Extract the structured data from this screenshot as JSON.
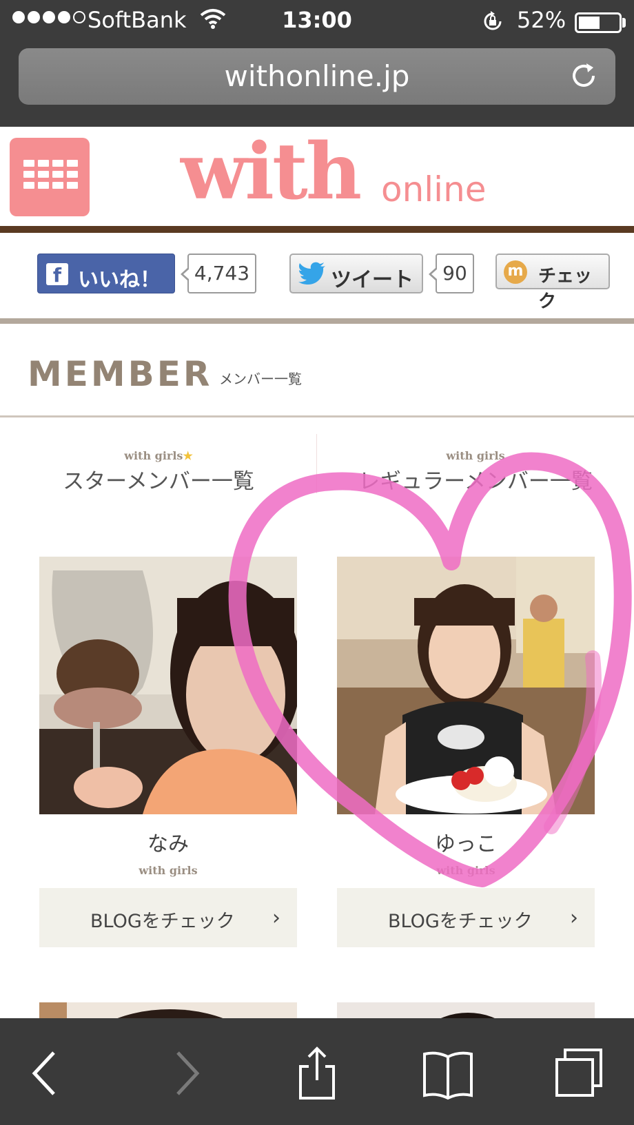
{
  "status_bar": {
    "carrier": "SoftBank",
    "time": "13:00",
    "battery_percent": "52%",
    "battery_level": 0.52,
    "signal_bars_filled": 4
  },
  "browser": {
    "url": "withonline.jp"
  },
  "site": {
    "logo_main": "with",
    "logo_sub": "online",
    "brand_color": "#f58e91"
  },
  "social": {
    "facebook_label": "いいね！",
    "facebook_count": "4,743",
    "tweet_label": "ツイート",
    "tweet_count": "90",
    "check_label": "チェック"
  },
  "members": {
    "title": "MEMBER",
    "subtitle": "メンバー一覧",
    "tabs": [
      {
        "small": "with girls",
        "label": "スターメンバー一覧"
      },
      {
        "small": "with girls",
        "label": "レギュラーメンバー一覧"
      }
    ],
    "cards": [
      {
        "name": "なみ",
        "small": "with girls",
        "button": "BLOGをチェック"
      },
      {
        "name": "ゆっこ",
        "small": "with girls",
        "button": "BLOGをチェック"
      }
    ]
  }
}
